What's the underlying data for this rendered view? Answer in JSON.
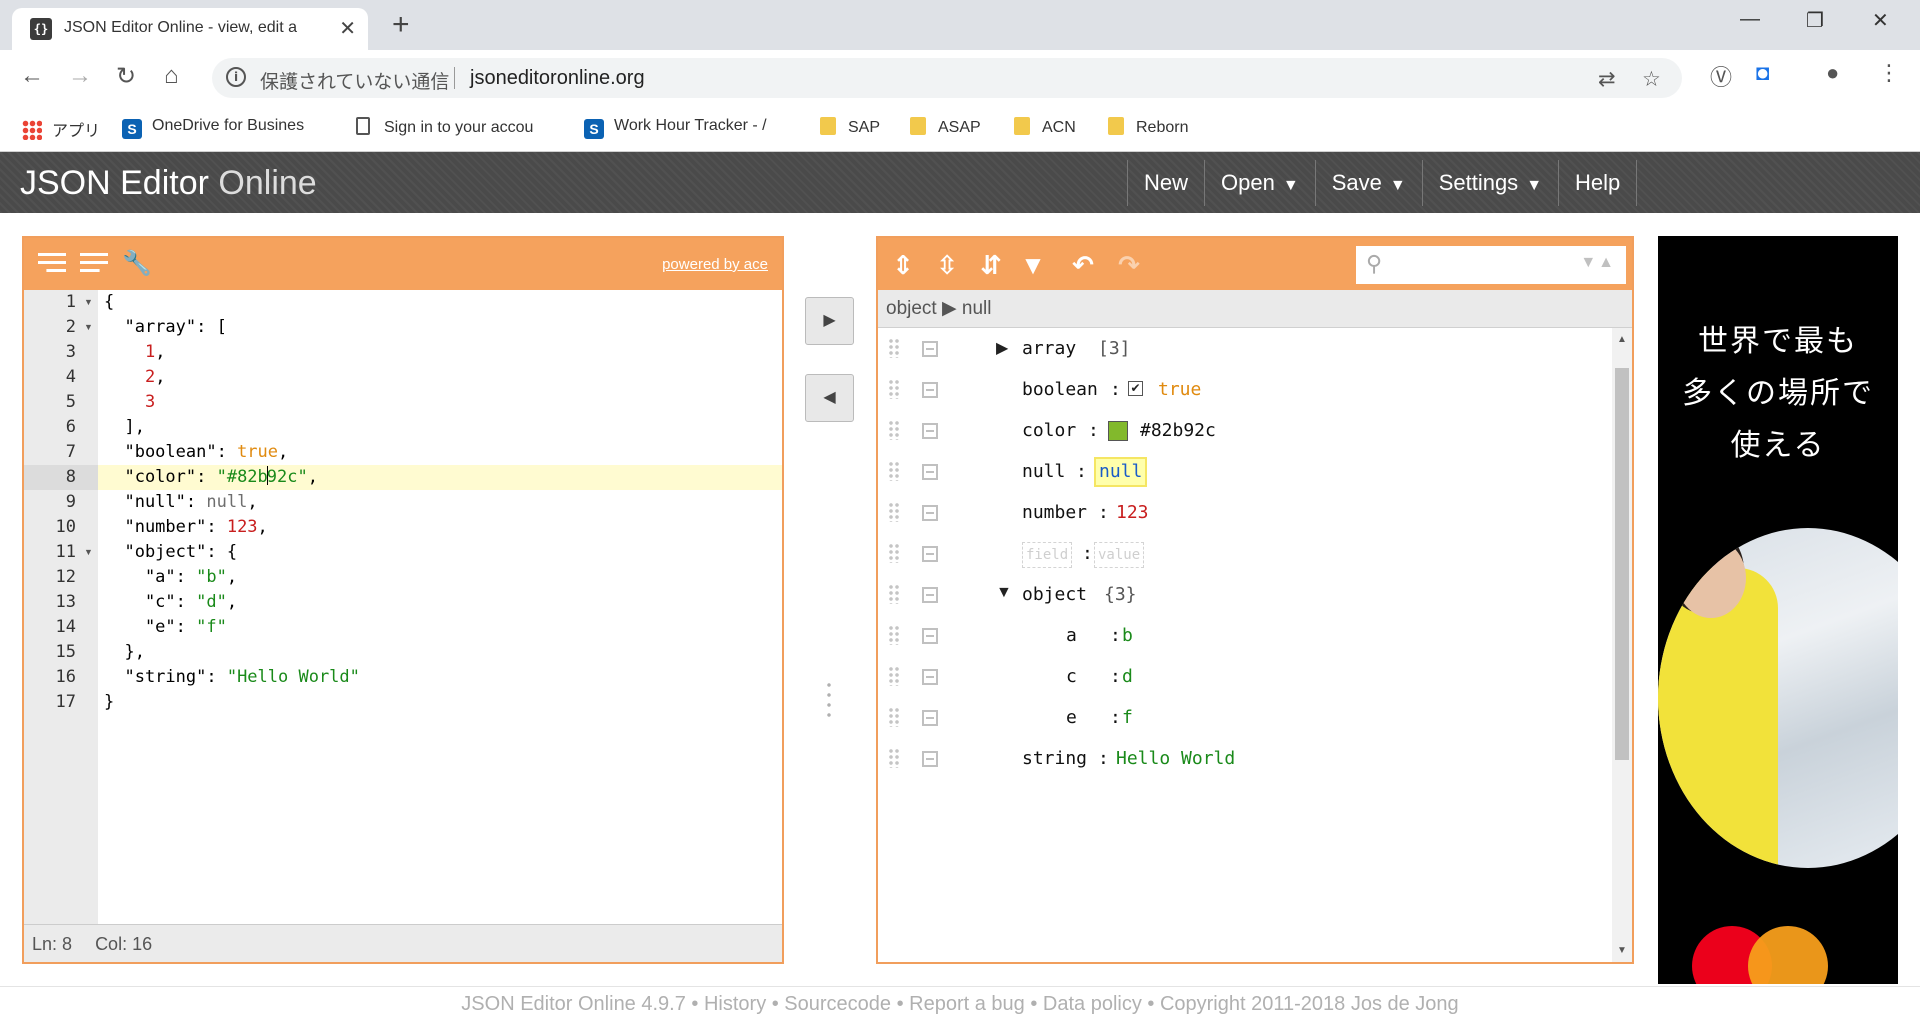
{
  "browser": {
    "tab_title": "JSON Editor Online - view, edit a",
    "url": "jsoneditoronline.org",
    "security_label": "保護されていない通信"
  },
  "bookmarks": [
    {
      "label": "アプリ",
      "icon": "apps-grid-icon"
    },
    {
      "label": "OneDrive for Busines",
      "icon": "sharepoint-icon"
    },
    {
      "label": "Sign in to your accou",
      "icon": "document-icon"
    },
    {
      "label": "Work Hour Tracker - /",
      "icon": "sharepoint-icon"
    },
    {
      "label": "SAP",
      "icon": "folder-icon"
    },
    {
      "label": "ASAP",
      "icon": "folder-icon"
    },
    {
      "label": "ACN",
      "icon": "folder-icon"
    },
    {
      "label": "Reborn",
      "icon": "folder-icon"
    }
  ],
  "app": {
    "logo_bold": "JSON Editor",
    "logo_thin": "Online",
    "menu": [
      "New",
      "Open",
      "Save",
      "Settings",
      "Help"
    ]
  },
  "code_panel": {
    "powered_by": "powered by ace",
    "line_numbers": [
      "1",
      "2",
      "3",
      "4",
      "5",
      "6",
      "7",
      "8",
      "9",
      "10",
      "11",
      "12",
      "13",
      "14",
      "15",
      "16",
      "17"
    ],
    "status_ln": "Ln: 8",
    "status_col": "Col: 16"
  },
  "tree_panel": {
    "navbar_root": "object",
    "navbar_arrow": "▶",
    "navbar_leaf": "null",
    "rows": [
      {
        "field": "array",
        "value": "[3]"
      },
      {
        "field": "boolean",
        "value": "true"
      },
      {
        "field": "color",
        "value": "#82b92c"
      },
      {
        "field": "null",
        "value": "null"
      },
      {
        "field": "number",
        "value": "123"
      },
      {
        "field": "field",
        "value": "value"
      },
      {
        "field": "object",
        "value": "{3}"
      },
      {
        "field": "a",
        "value": "b"
      },
      {
        "field": "c",
        "value": "d"
      },
      {
        "field": "e",
        "value": "f"
      },
      {
        "field": "string",
        "value": "Hello World"
      }
    ]
  },
  "ad": {
    "line1": "世界で最も",
    "line2": "多くの場所で",
    "line3": "使える"
  },
  "footer": "JSON Editor Online 4.9.7 • History • Sourcecode • Report a bug • Data policy • Copyright 2011-2018 Jos de Jong",
  "colors": {
    "accent": "#f5a25d",
    "header": "#4a4a4a",
    "swatch": "#82b92c"
  }
}
